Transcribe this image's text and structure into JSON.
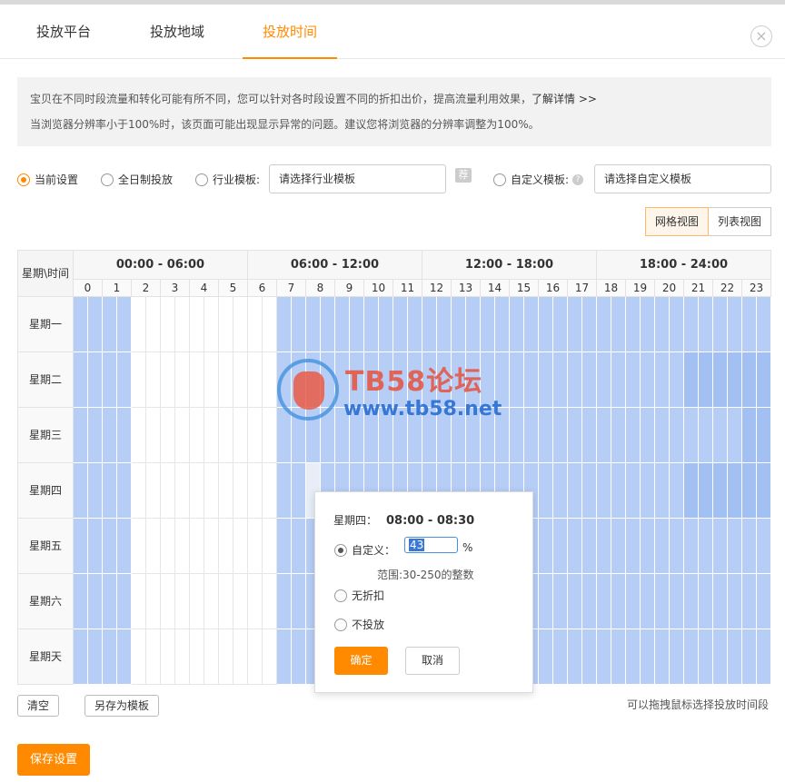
{
  "tabs": [
    {
      "label": "投放平台",
      "active": false
    },
    {
      "label": "投放地域",
      "active": false
    },
    {
      "label": "投放时间",
      "active": true
    }
  ],
  "close_icon": "close-icon",
  "notice": {
    "line1": "宝贝在不同时段流量和转化可能有所不同，您可以针对各时段设置不同的折扣出价，提高流量利用效果，",
    "line1_link": "了解详情 >>",
    "line2": "当浏览器分辨率小于100%时，该页面可能出现显示异常的问题。建议您将浏览器的分辨率调整为100%。"
  },
  "options": {
    "current": "当前设置",
    "allday": "全日制投放",
    "industry_label": "行业模板:",
    "industry_placeholder": "请选择行业模板",
    "recommend_badge": "荐",
    "custom_label": "自定义模板:",
    "custom_placeholder": "请选择自定义模板",
    "selected": "current"
  },
  "view_toggle": {
    "grid": "网格视图",
    "list": "列表视图",
    "active": "grid"
  },
  "schedule": {
    "corner": "星期\\时间",
    "periods": [
      "00:00 - 06:00",
      "06:00 - 12:00",
      "12:00 - 18:00",
      "18:00 - 24:00"
    ],
    "hours": [
      "0",
      "1",
      "2",
      "3",
      "4",
      "5",
      "6",
      "7",
      "8",
      "9",
      "10",
      "11",
      "12",
      "13",
      "14",
      "15",
      "16",
      "17",
      "18",
      "19",
      "20",
      "21",
      "22",
      "23"
    ],
    "days": [
      "星期一",
      "星期二",
      "星期三",
      "星期四",
      "星期五",
      "星期六",
      "星期天"
    ],
    "levels": [
      [
        1,
        1,
        1,
        1,
        0,
        0,
        0,
        0,
        0,
        0,
        0,
        0,
        0,
        0,
        1,
        1,
        1,
        1,
        1,
        1,
        1,
        1,
        1,
        1,
        1,
        1,
        1,
        1,
        1,
        1,
        1,
        1,
        1,
        1,
        1,
        1,
        1,
        1,
        1,
        1,
        1,
        1,
        1,
        1,
        1,
        1,
        1,
        1
      ],
      [
        1,
        1,
        1,
        1,
        0,
        0,
        0,
        0,
        0,
        0,
        0,
        0,
        0,
        0,
        1,
        1,
        1,
        1,
        1,
        1,
        1,
        1,
        1,
        1,
        1,
        1,
        1,
        1,
        1,
        1,
        1,
        1,
        1,
        1,
        1,
        1,
        1,
        1,
        1,
        1,
        1,
        1,
        2,
        2,
        2,
        2,
        2,
        2
      ],
      [
        1,
        1,
        1,
        1,
        0,
        0,
        0,
        0,
        0,
        0,
        0,
        0,
        0,
        0,
        1,
        1,
        1,
        1,
        1,
        1,
        1,
        1,
        1,
        1,
        1,
        1,
        1,
        1,
        1,
        1,
        1,
        1,
        1,
        1,
        1,
        1,
        1,
        1,
        1,
        1,
        1,
        1,
        1,
        1,
        1,
        1,
        2,
        2
      ],
      [
        1,
        1,
        1,
        1,
        0,
        0,
        0,
        0,
        0,
        0,
        0,
        0,
        0,
        0,
        1,
        1,
        1,
        1,
        1,
        1,
        1,
        1,
        1,
        1,
        1,
        1,
        1,
        1,
        1,
        1,
        1,
        1,
        1,
        1,
        1,
        1,
        1,
        1,
        1,
        1,
        1,
        1,
        2,
        2,
        2,
        2,
        2,
        2
      ],
      [
        1,
        1,
        1,
        1,
        0,
        0,
        0,
        0,
        0,
        0,
        0,
        0,
        0,
        0,
        1,
        1,
        1,
        1,
        1,
        1,
        1,
        1,
        1,
        1,
        1,
        1,
        1,
        1,
        1,
        1,
        1,
        1,
        1,
        1,
        1,
        1,
        1,
        1,
        1,
        1,
        1,
        1,
        1,
        1,
        1,
        1,
        1,
        1
      ],
      [
        1,
        1,
        1,
        1,
        0,
        0,
        0,
        0,
        0,
        0,
        0,
        0,
        0,
        0,
        1,
        1,
        1,
        1,
        1,
        1,
        1,
        1,
        1,
        1,
        1,
        1,
        1,
        1,
        1,
        1,
        1,
        1,
        1,
        1,
        1,
        1,
        1,
        1,
        1,
        1,
        1,
        1,
        1,
        1,
        1,
        1,
        1,
        1
      ],
      [
        1,
        1,
        1,
        1,
        0,
        0,
        0,
        0,
        0,
        0,
        0,
        0,
        0,
        0,
        1,
        1,
        1,
        1,
        1,
        1,
        1,
        1,
        1,
        1,
        1,
        1,
        1,
        1,
        1,
        1,
        1,
        1,
        1,
        1,
        1,
        1,
        1,
        1,
        1,
        1,
        1,
        1,
        1,
        1,
        1,
        1,
        1,
        1
      ]
    ],
    "selected_slot": {
      "day": 3,
      "half_hour": 16
    }
  },
  "watermark": {
    "title": "TB58论坛",
    "url": "www.tb58.net"
  },
  "popup": {
    "day": "星期四：",
    "time": "08:00 - 08:30",
    "custom_label": "自定义：",
    "value": "43",
    "percent": "%",
    "range_hint": "范围:30-250的整数",
    "no_discount": "无折扣",
    "no_delivery": "不投放",
    "ok": "确定",
    "cancel": "取消",
    "selected": "custom"
  },
  "footer": {
    "clear": "清空",
    "save_template": "另存为模板",
    "drag_hint": "可以拖拽鼠标选择投放时间段",
    "save": "保存设置"
  }
}
